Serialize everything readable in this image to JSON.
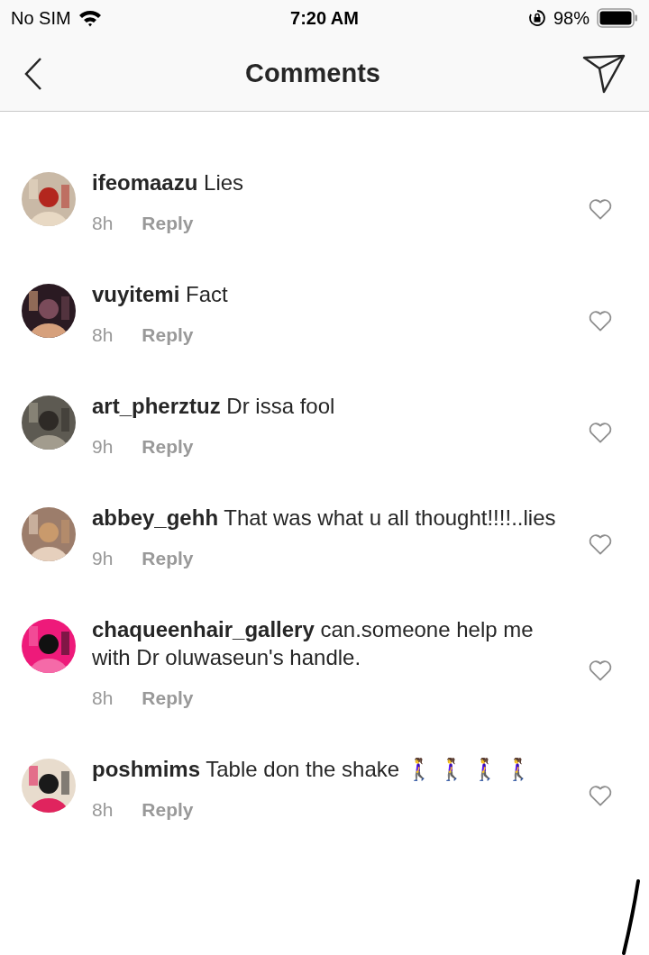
{
  "status_bar": {
    "carrier": "No SIM",
    "time": "7:20 AM",
    "battery": "98%"
  },
  "header": {
    "title": "Comments"
  },
  "comments": [
    {
      "username": "ifeomaazu",
      "text": "Lies",
      "time": "8h",
      "reply": "Reply",
      "liked": false
    },
    {
      "username": "vuyitemi",
      "text": "Fact",
      "time": "8h",
      "reply": "Reply",
      "liked": false
    },
    {
      "username": "art_pherztuz",
      "text": "Dr issa fool",
      "time": "9h",
      "reply": "Reply",
      "liked": false
    },
    {
      "username": "abbey_gehh",
      "text": "That was what u all thought!!!!..lies",
      "time": "9h",
      "reply": "Reply",
      "liked": false
    },
    {
      "username": "chaqueenhair_gallery",
      "text": "can.someone help me with Dr oluwaseun's handle.",
      "time": "8h",
      "reply": "Reply",
      "liked": false
    },
    {
      "username": "poshmims",
      "text": "Table don the shake 🚶‍♀️ 🚶‍♀️ 🚶‍♀️ 🚶‍♀️",
      "time": "8h",
      "reply": "Reply",
      "liked": false
    }
  ]
}
